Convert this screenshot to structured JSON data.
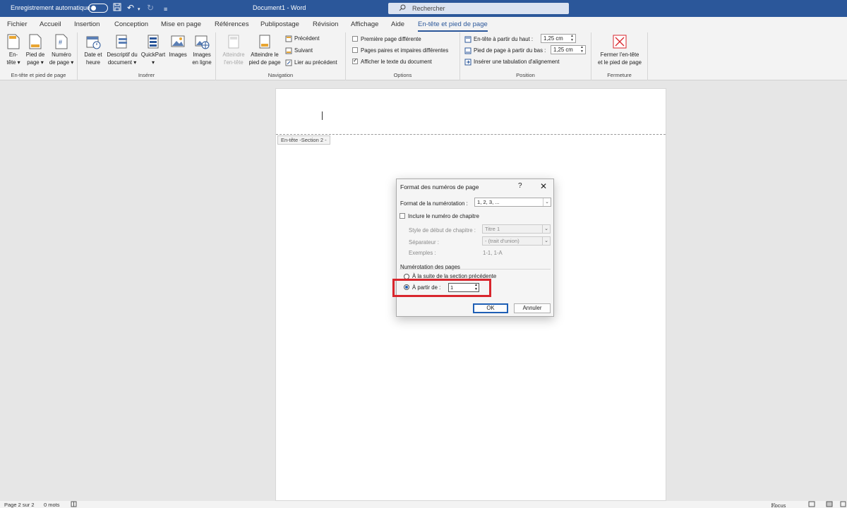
{
  "titlebar": {
    "autosave_label": "Enregistrement automatique",
    "doc_title": "Document1  -  Word",
    "search_placeholder": "Rechercher"
  },
  "tabs": [
    {
      "label": "Fichier"
    },
    {
      "label": "Accueil"
    },
    {
      "label": "Insertion"
    },
    {
      "label": "Conception"
    },
    {
      "label": "Mise en page"
    },
    {
      "label": "Références"
    },
    {
      "label": "Publipostage"
    },
    {
      "label": "Révision"
    },
    {
      "label": "Affichage"
    },
    {
      "label": "Aide"
    },
    {
      "label": "En-tête et pied de page",
      "active": true
    }
  ],
  "ribbon": {
    "group_header_footer": {
      "label": "En-tête et pied de page",
      "entete": [
        "En-",
        "tête ▾"
      ],
      "pied": [
        "Pied de",
        "page ▾"
      ],
      "numero": [
        "Numéro",
        "de page ▾"
      ]
    },
    "group_insert": {
      "label": "Insérer",
      "date": [
        "Date et",
        "heure"
      ],
      "descriptif": [
        "Descriptif du",
        "document ▾"
      ],
      "quickpart": [
        "QuickPart",
        "▾"
      ],
      "images": [
        "Images",
        ""
      ],
      "images_ligne": [
        "Images",
        "en ligne"
      ]
    },
    "group_navigation": {
      "label": "Navigation",
      "atteindre_entete": [
        "Atteindre",
        "l'en-tête"
      ],
      "atteindre_pied": [
        "Atteindre le",
        "pied de page"
      ],
      "precedent": "Précédent",
      "suivant": "Suivant",
      "lier": "Lier au précédent"
    },
    "group_options": {
      "label": "Options",
      "premiere": "Première page différente",
      "paires": "Pages paires et impaires différentes",
      "afficher": "Afficher le texte du document"
    },
    "group_position": {
      "label": "Position",
      "entete_haut": "En-tête à partir du haut :",
      "entete_haut_value": "1,25 cm",
      "pied_bas": "Pied de page à partir du bas :",
      "pied_bas_value": "1,25 cm",
      "tabulation": "Insérer une tabulation d'alignement"
    },
    "group_close": {
      "label": "Fermeture",
      "close": [
        "Fermer l'en-tête",
        "et le pied de page"
      ]
    }
  },
  "document": {
    "header_tag": "En-tête -Section 2 -"
  },
  "dialog": {
    "title": "Format des numéros de page",
    "help": "?",
    "close": "✕",
    "format_label": "Format de la numérotation :",
    "format_value": "1, 2, 3, ...",
    "include_chapter": "Inclure le numéro de chapitre",
    "chapter_style_label": "Style de début de chapitre :",
    "chapter_style_value": "Titre 1",
    "separator_label": "Séparateur :",
    "separator_value": "-     (trait d'union)",
    "examples_label": "Exemples :",
    "examples_value": "1-1, 1-A",
    "numbering_section": "Numérotation des pages",
    "continue_option": "À la suite de la section précédente",
    "start_at_label": "À partir de :",
    "start_at_value": "1",
    "ok": "OK",
    "cancel": "Annuler"
  },
  "statusbar": {
    "page": "Page 2 sur 2",
    "words": "0 mots",
    "focus": "Focus"
  },
  "colors": {
    "accent": "#2b579a",
    "highlight": "#d9262d"
  }
}
